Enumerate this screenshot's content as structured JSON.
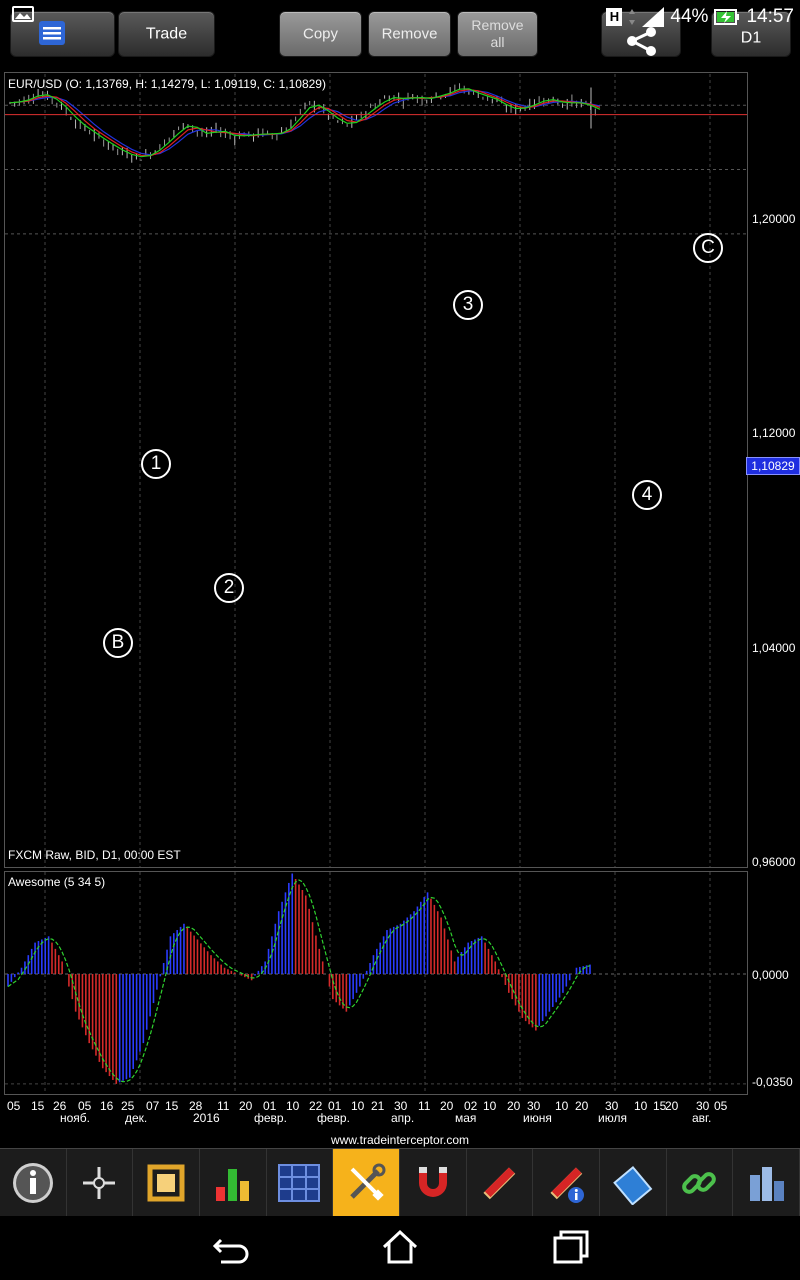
{
  "topbar": {
    "trade_label": "Trade",
    "copy_label": "Copy",
    "remove_label": "Remove",
    "remove_all_line1": "Remove",
    "remove_all_line2": "all",
    "timeframe_label": "D1"
  },
  "status": {
    "h_badge": "H",
    "battery": "44%",
    "time": "14:57"
  },
  "chart": {
    "title": "EUR/USD (O: 1,13769, H: 1,14279, L: 1,09119, C: 1,10829)",
    "footer": "FXCM Raw, BID, D1, 00:00 EST",
    "current_price": "1,10829",
    "y_ticks": [
      "1,20000",
      "1,12000",
      "1,04000",
      "0,96000"
    ],
    "indicator_title": "Awesome (5 34 5)",
    "indicator_y_ticks": [
      "0,0000",
      "-0,0350"
    ],
    "x_day_labels": [
      "05",
      "15",
      "26",
      "05",
      "16",
      "25",
      "07",
      "15",
      "28",
      "11",
      "20",
      "01",
      "10",
      "22",
      "01",
      "10",
      "21",
      "30",
      "11",
      "20",
      "02",
      "10",
      "20",
      "30",
      "10",
      "20",
      "30",
      "10",
      "15",
      "20",
      "30",
      "05"
    ],
    "x_month_labels": [
      "нояб.",
      "дек.",
      "2016",
      "февр.",
      "февр.",
      "апр.",
      "мая",
      "июня",
      "июля",
      "авг."
    ],
    "annotations": [
      "1",
      "2",
      "3",
      "4",
      "B",
      "C"
    ],
    "watermark": "www.tradeinterceptor.com",
    "colors": {
      "up": "#2a3cff",
      "down": "#d52a2a",
      "ma_green": "#1fd11f",
      "ma_red": "#e02020",
      "ma_blue": "#2233dd",
      "price_line": "#e03030"
    }
  },
  "chart_data": {
    "type": "candlestick",
    "title": "EUR/USD (O: 1,13769, H: 1,14279, L: 1,09119, C: 1,10829)",
    "ylim": [
      0.96,
      1.24
    ],
    "y_ticks": [
      0.96,
      1.04,
      1.12,
      1.2
    ],
    "current_price": 1.10829,
    "close_path": [
      1.123,
      1.125,
      1.128,
      1.135,
      1.131,
      1.124,
      1.112,
      1.099,
      1.091,
      1.083,
      1.075,
      1.068,
      1.061,
      1.057,
      1.055,
      1.06,
      1.068,
      1.08,
      1.09,
      1.098,
      1.087,
      1.083,
      1.09,
      1.085,
      1.08,
      1.084,
      1.082,
      1.086,
      1.083,
      1.087,
      1.095,
      1.112,
      1.122,
      1.118,
      1.108,
      1.1,
      1.095,
      1.102,
      1.112,
      1.12,
      1.128,
      1.131,
      1.126,
      1.132,
      1.127,
      1.13,
      1.133,
      1.137,
      1.143,
      1.138,
      1.133,
      1.13,
      1.125,
      1.117,
      1.115,
      1.118,
      1.122,
      1.128,
      1.126,
      1.122,
      1.124,
      1.122,
      1.118,
      1.112
    ],
    "indicator": {
      "name": "Awesome (5 34 5)",
      "ylim": [
        -0.038,
        0.034
      ],
      "values": [
        -0.004,
        0.002,
        0.01,
        0.012,
        0.004,
        -0.012,
        -0.022,
        -0.03,
        -0.035,
        -0.033,
        -0.022,
        -0.005,
        0.012,
        0.016,
        0.011,
        0.006,
        0.002,
        0.0,
        -0.002,
        0.004,
        0.02,
        0.032,
        0.025,
        0.008,
        -0.008,
        -0.012,
        -0.004,
        0.006,
        0.014,
        0.016,
        0.02,
        0.026,
        0.018,
        0.004,
        0.01,
        0.012,
        0.004,
        -0.006,
        -0.014,
        -0.018,
        -0.012,
        -0.006,
        0.002,
        0.003
      ]
    }
  }
}
